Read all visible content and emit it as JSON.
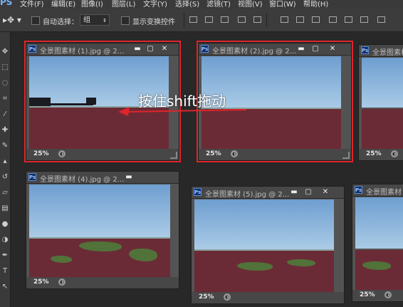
{
  "menu": {
    "logo": "PS",
    "items": [
      "文件(F)",
      "编辑(E)",
      "图像(I)",
      "图层(L)",
      "文字(Y)",
      "选择(S)",
      "滤镜(T)",
      "视图(V)",
      "窗口(W)",
      "帮助(H)"
    ]
  },
  "options": {
    "auto_select_label": "自动选择：",
    "auto_select_target": "组",
    "show_transform_label": "显示变换控件"
  },
  "icons": {
    "move": "move-icon",
    "marquee": "marquee-icon",
    "lasso": "lasso-icon",
    "crop": "crop-icon",
    "eyedropper": "eyedropper-icon",
    "brush": "brush-icon",
    "stamp": "stamp-icon",
    "eraser": "eraser-icon",
    "gradient": "gradient-icon",
    "dodge": "dodge-icon",
    "pen": "pen-icon",
    "type": "type-icon",
    "path_select": "path-select-icon"
  },
  "windows": [
    {
      "title": "全景图素材 (1).jpg @ 2...",
      "zoom": "25%"
    },
    {
      "title": "全景图素材 (2).jpg @ 2...",
      "zoom": "25%"
    },
    {
      "title": "全景图素材",
      "zoom": "25%"
    },
    {
      "title": "全景图素材 (4).jpg @ 2...",
      "zoom": "25%"
    },
    {
      "title": "全景图素材 (5).jpg @ 2...",
      "zoom": "25%"
    },
    {
      "title": "全景图素材",
      "zoom": "25%"
    }
  ],
  "annotation": {
    "text": "按住shift拖动",
    "highlight_color": "#e0242b"
  },
  "colors": {
    "workspace": "#282828",
    "panel": "#3c3c3c",
    "accent_red": "#e0242b"
  }
}
